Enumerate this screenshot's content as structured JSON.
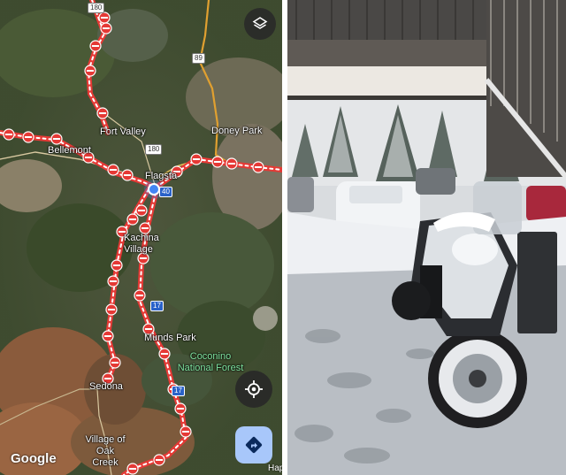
{
  "map": {
    "places": {
      "fort_valley": "Fort Valley",
      "doney_park": "Doney Park",
      "bellemont": "Bellemont",
      "flagstaff": "Flagsta",
      "kachina_village": "Kachina Village",
      "munds_park": "Munds Park",
      "sedona": "Sedona",
      "village_of_oak_creek": "Village of Oak Creek",
      "edge_label": "Hap"
    },
    "forest_label": "Coconino National Forest",
    "shields": {
      "us180_top": "180",
      "us89": "89",
      "us180_mid": "180",
      "i40": "40",
      "i17_a": "17",
      "i17_b": "17"
    },
    "branding": "Google",
    "controls": {
      "layers_icon": "layers-icon",
      "locate_icon": "my-location-icon",
      "directions_icon": "directions-icon"
    },
    "colors": {
      "closure_red": "#e53935",
      "closure_stripe": "#ffffff",
      "user_location": "#4285f4",
      "directions_bg": "#a8c7fa"
    }
  },
  "photo": {
    "subject": "snow-covered-motorcycle"
  }
}
